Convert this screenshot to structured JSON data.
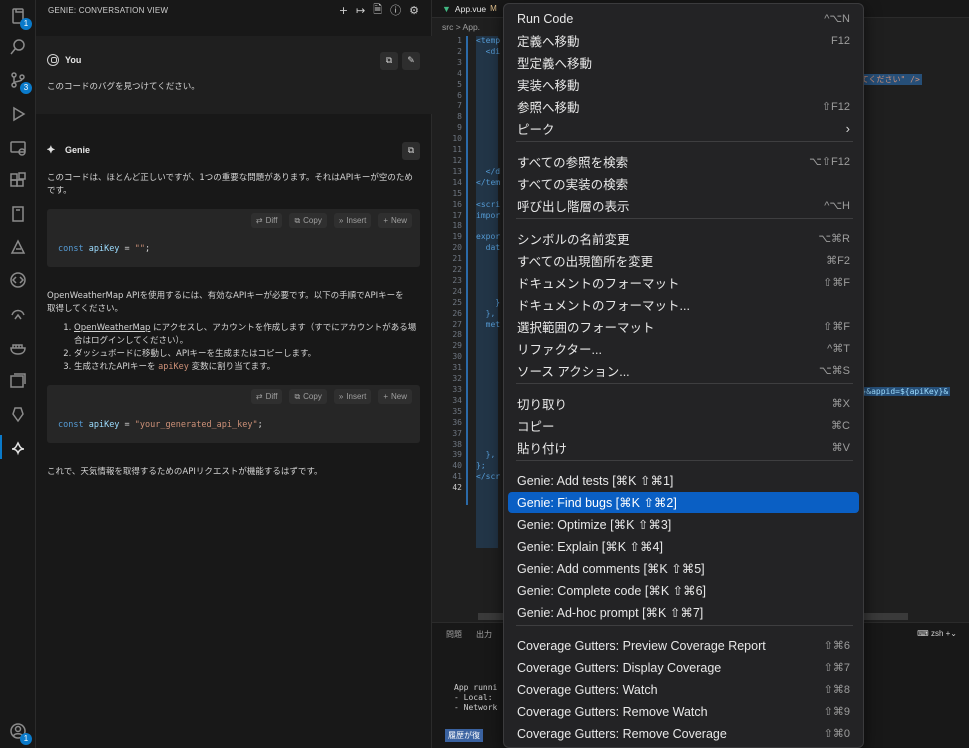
{
  "activity": {
    "badges": [
      "3",
      "1"
    ]
  },
  "sidebar": {
    "title": "GENIE: CONVERSATION VIEW",
    "actions": [
      "+",
      "↦",
      "🗎",
      "ⓘ",
      "⚙"
    ]
  },
  "user_msg": {
    "who": "You",
    "text": "このコードのバグを見つけてください。"
  },
  "genie_msg": {
    "who": "Genie",
    "intro": "このコードは、ほとんど正しいですが、1つの重要な問題があります。それはAPIキーが空のためです。",
    "code1": {
      "kw": "const",
      "var": "apiKey",
      "op": " = ",
      "str": "\"\"",
      "end": ";"
    },
    "para2": "OpenWeatherMap APIを使用するには、有効なAPIキーが必要です。以下の手順でAPIキーを取得してください。",
    "steps": [
      {
        "link": "OpenWeatherMap",
        "text": " にアクセスし、アカウントを作成します（すでにアカウントがある場合はログインしてください）。"
      },
      {
        "text": "ダッシュボードに移動し、APIキーを生成またはコピーします。"
      },
      {
        "pre": "生成されたAPIキーを ",
        "code": "apiKey",
        "post": " 変数に割り当てます。"
      }
    ],
    "code2": {
      "kw": "const",
      "var": "apiKey",
      "op": " = ",
      "str": "\"your_generated_api_key\"",
      "end": ";"
    },
    "closing": "これで、天気情報を取得するためのAPIリクエストが機能するはずです。",
    "buttons": {
      "diff": "Diff",
      "copy": "Copy",
      "insert": "Insert",
      "new": "New"
    }
  },
  "editor": {
    "tab": "App.vue",
    "tab_badge": "M",
    "crumb": "src > App.",
    "line_numbers": [
      "1",
      "2",
      "3",
      "4",
      "5",
      "6",
      "7",
      "8",
      "9",
      "10",
      "11",
      "12",
      "13",
      "14",
      "15",
      "16",
      "17",
      "18",
      "19",
      "20",
      "21",
      "22",
      "23",
      "24",
      "25",
      "26",
      "27",
      "28",
      "29",
      "30",
      "31",
      "32",
      "33",
      "34",
      "35",
      "36",
      "37",
      "38",
      "39",
      "40",
      "41",
      "42"
    ],
    "snip1": "してください\" />",
    "snip2": "ity}&appid=${apiKey}&",
    "code_lines": [
      "<temp",
      "  <di",
      "",
      "",
      "",
      "",
      "",
      "",
      "",
      "",
      "",
      "",
      "  </d",
      "</tem",
      "",
      "<scri",
      "impor",
      "",
      "expor",
      "  dat",
      "",
      "",
      "",
      "",
      "    }",
      "  },",
      "  met",
      "",
      "",
      "",
      "",
      "",
      "",
      "",
      "",
      "",
      "",
      "",
      "  },",
      "};",
      "</scr",
      ""
    ]
  },
  "panel": {
    "tabs": [
      "問題",
      "出力"
    ],
    "right": "zsh",
    "terminal": "App runni\n- Local:  \n- Network",
    "bottom": "履歴が復"
  },
  "menu": {
    "items": [
      {
        "label": "Run Code",
        "shortcut": "^⌥N"
      },
      {
        "label": "定義へ移動",
        "shortcut": "F12"
      },
      {
        "label": "型定義へ移動",
        "shortcut": ""
      },
      {
        "label": "実装へ移動",
        "shortcut": ""
      },
      {
        "label": "参照へ移動",
        "shortcut": "⇧F12"
      },
      {
        "label": "ピーク",
        "shortcut": "",
        "submenu": true
      },
      {
        "label": "すべての参照を検索",
        "shortcut": "⌥⇧F12"
      },
      {
        "label": "すべての実装の検索",
        "shortcut": ""
      },
      {
        "label": "呼び出し階層の表示",
        "shortcut": "^⌥H"
      },
      {
        "label": "シンボルの名前変更",
        "shortcut": "⌥⌘R"
      },
      {
        "label": "すべての出現箇所を変更",
        "shortcut": "⌘F2"
      },
      {
        "label": "ドキュメントのフォーマット",
        "shortcut": "⇧⌘F"
      },
      {
        "label": "ドキュメントのフォーマット...",
        "shortcut": ""
      },
      {
        "label": "選択範囲のフォーマット",
        "shortcut": "⇧⌘F"
      },
      {
        "label": "リファクター...",
        "shortcut": "^⌘T"
      },
      {
        "label": "ソース アクション...",
        "shortcut": "⌥⌘S"
      },
      {
        "label": "切り取り",
        "shortcut": "⌘X"
      },
      {
        "label": "コピー",
        "shortcut": "⌘C"
      },
      {
        "label": "貼り付け",
        "shortcut": "⌘V"
      },
      {
        "label": "Genie: Add tests [⌘K ⇧⌘1]",
        "shortcut": ""
      },
      {
        "label": "Genie: Find bugs [⌘K ⇧⌘2]",
        "shortcut": "",
        "selected": true
      },
      {
        "label": "Genie: Optimize [⌘K ⇧⌘3]",
        "shortcut": ""
      },
      {
        "label": "Genie: Explain [⌘K ⇧⌘4]",
        "shortcut": ""
      },
      {
        "label": "Genie: Add comments [⌘K ⇧⌘5]",
        "shortcut": ""
      },
      {
        "label": "Genie: Complete code [⌘K ⇧⌘6]",
        "shortcut": ""
      },
      {
        "label": "Genie: Ad-hoc prompt [⌘K ⇧⌘7]",
        "shortcut": ""
      },
      {
        "label": "Coverage Gutters: Preview Coverage Report",
        "shortcut": "⇧⌘6"
      },
      {
        "label": "Coverage Gutters: Display Coverage",
        "shortcut": "⇧⌘7"
      },
      {
        "label": "Coverage Gutters: Watch",
        "shortcut": "⇧⌘8"
      },
      {
        "label": "Coverage Gutters: Remove Watch",
        "shortcut": "⇧⌘9"
      },
      {
        "label": "Coverage Gutters: Remove Coverage",
        "shortcut": "⇧⌘0"
      }
    ]
  }
}
